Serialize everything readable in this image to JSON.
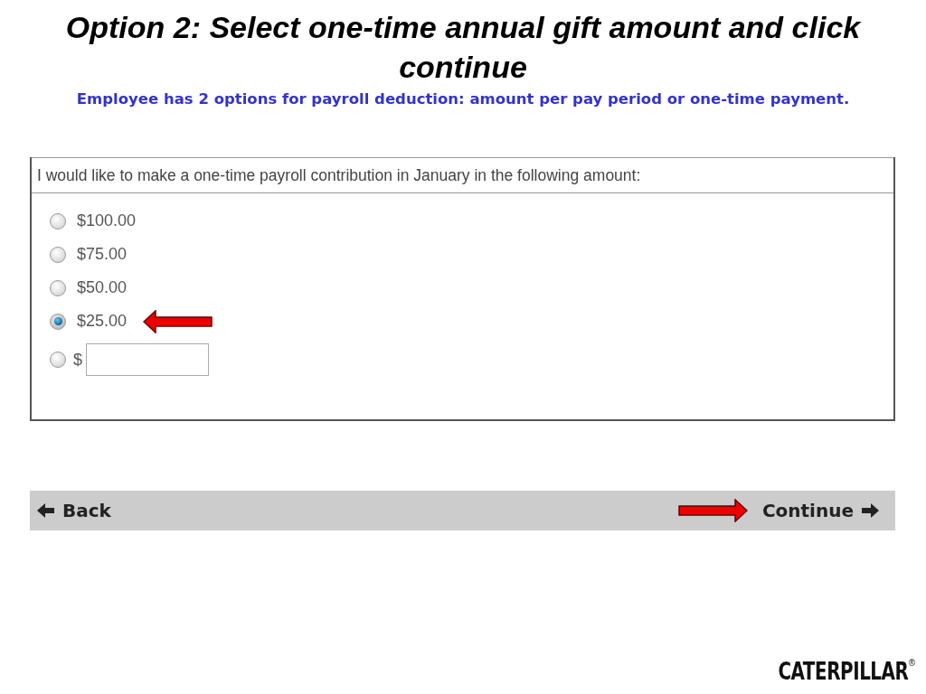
{
  "slide": {
    "title": "Option 2: Select one-time annual gift amount and click continue",
    "subtitle": "Employee has 2 options for payroll deduction: amount per pay period or one-time payment."
  },
  "form": {
    "prompt": "I would like to make a one-time payroll contribution in January in the following amount:",
    "options": [
      {
        "kind": "preset",
        "label": "$100.00",
        "selected": false,
        "arrow": false
      },
      {
        "kind": "preset",
        "label": "$75.00",
        "selected": false,
        "arrow": false
      },
      {
        "kind": "preset",
        "label": "$50.00",
        "selected": false,
        "arrow": false
      },
      {
        "kind": "preset",
        "label": "$25.00",
        "selected": true,
        "arrow": true
      },
      {
        "kind": "custom",
        "label": "$",
        "selected": false,
        "arrow": false
      }
    ]
  },
  "nav": {
    "back": "Back",
    "continue": "Continue",
    "continue_arrow": true
  },
  "logo": {
    "text": "CATERPILLAR",
    "mark": "®"
  }
}
